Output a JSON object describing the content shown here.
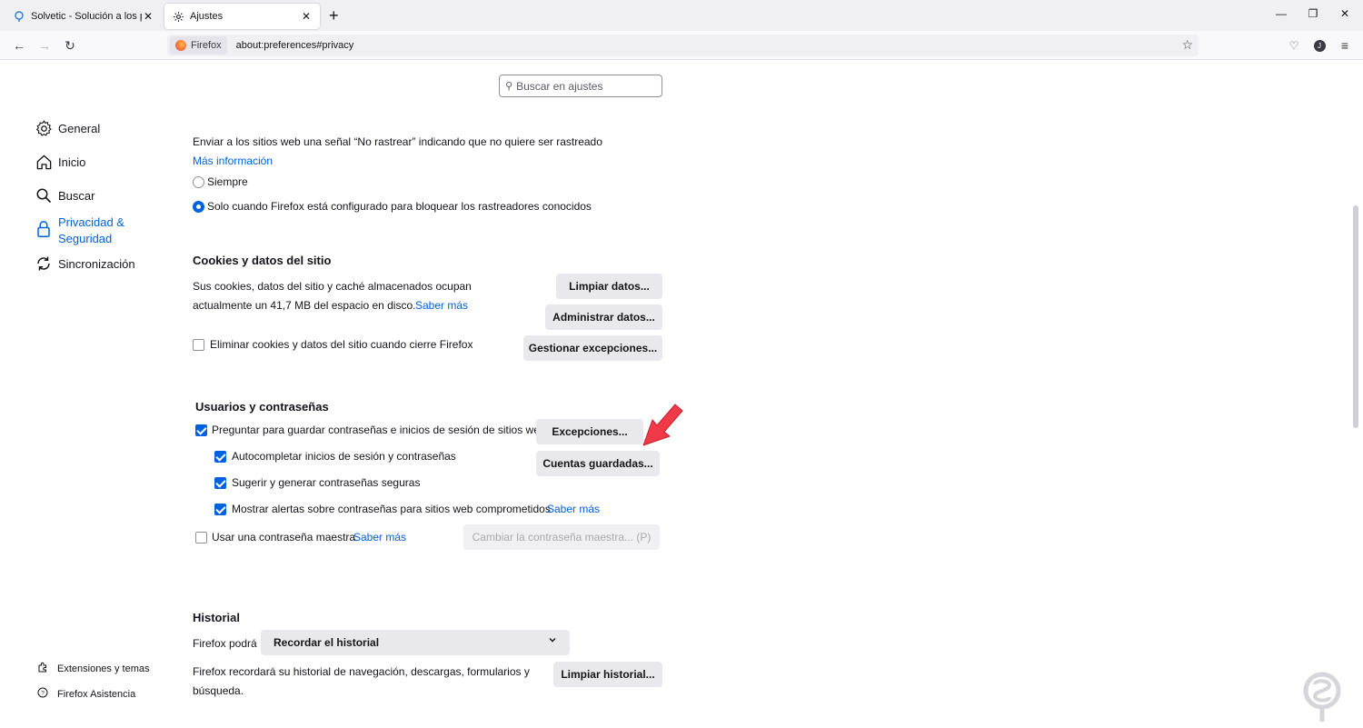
{
  "tabs": [
    {
      "title": "Solvetic - Solución a los problem",
      "icon": "solvetic-icon"
    },
    {
      "title": "Ajustes",
      "icon": "gear-icon"
    }
  ],
  "nav": {
    "identity_label": "Firefox",
    "url": "about:preferences#privacy"
  },
  "search": {
    "placeholder": "Buscar en ajustes"
  },
  "sidebar": {
    "items": [
      {
        "label": "General",
        "icon": "gear-icon"
      },
      {
        "label": "Inicio",
        "icon": "home-icon"
      },
      {
        "label": "Buscar",
        "icon": "search-icon"
      },
      {
        "label": "Privacidad &",
        "label2": "Seguridad",
        "icon": "lock-icon",
        "selected": true
      },
      {
        "label": "Sincronización",
        "icon": "sync-icon"
      }
    ],
    "footer": [
      {
        "label": "Extensiones y temas",
        "icon": "puzzle-icon"
      },
      {
        "label": "Firefox Asistencia",
        "icon": "help-icon"
      }
    ]
  },
  "dnt": {
    "description": "Enviar a los sitios web una señal “No rastrear” indicando que no quiere ser rastreado",
    "more_info": "Más información",
    "option_always": "Siempre",
    "option_only": "Solo cuando Firefox está configurado para bloquear los rastreadores conocidos"
  },
  "cookies": {
    "title": "Cookies y datos del sitio",
    "desc_line1": "Sus cookies, datos del sitio y caché almacenados ocupan",
    "desc_line2": "actualmente un 41,7 MB del espacio en disco.",
    "learn_more": "Saber más",
    "delete_on_close": "Eliminar cookies y datos del sitio cuando cierre Firefox",
    "btn_clear": "Limpiar datos...",
    "btn_manage": "Administrar datos...",
    "btn_exceptions": "Gestionar excepciones..."
  },
  "logins": {
    "title": "Usuarios y contraseñas",
    "ask_save": "Preguntar para guardar contraseñas e inicios de sesión de sitios web",
    "autofill": "Autocompletar inicios de sesión y contraseñas",
    "suggest": "Sugerir y generar contraseñas seguras",
    "alerts": "Mostrar alertas sobre contraseñas para sitios web comprometidos",
    "alerts_learn_more": "Saber más",
    "master": "Usar una contraseña maestra",
    "master_learn_more": "Saber más",
    "btn_exceptions": "Excepciones...",
    "btn_saved": "Cuentas guardadas...",
    "btn_change_master": "Cambiar la contraseña maestra... (P)"
  },
  "history": {
    "title": "Historial",
    "will": "Firefox podrá",
    "mode": "Recordar el historial",
    "desc_line1": "Firefox recordará su historial de navegación, descargas, formularios y",
    "desc_line2": "búsqueda.",
    "btn_clear": "Limpiar historial..."
  },
  "colors": {
    "accent": "#0061e0",
    "annotation_arrow": "#f03a47"
  }
}
